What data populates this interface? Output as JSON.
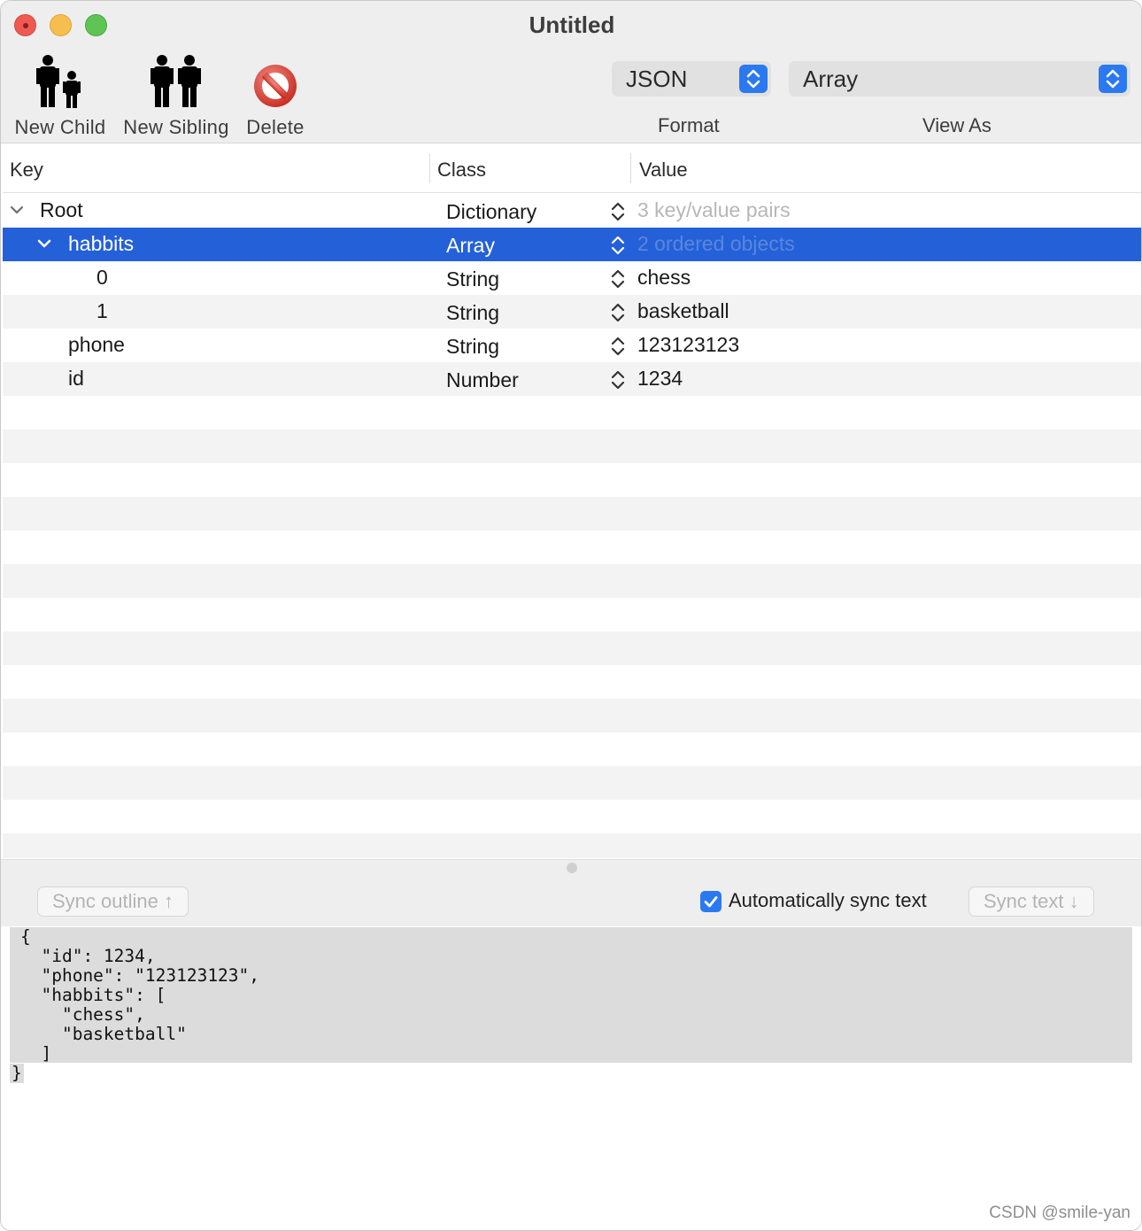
{
  "window": {
    "title": "Untitled"
  },
  "toolbar": {
    "new_child": "New Child",
    "new_sibling": "New Sibling",
    "delete": "Delete",
    "format_value": "JSON",
    "format_caption": "Format",
    "view_as_value": "Array",
    "view_as_caption": "View As"
  },
  "columns": {
    "key": "Key",
    "class": "Class",
    "value": "Value"
  },
  "rows": [
    {
      "key": "Root",
      "class": "Dictionary",
      "value": "3 key/value pairs",
      "expanded": true
    },
    {
      "key": "habbits",
      "class": "Array",
      "value": "2 ordered objects",
      "expanded": true,
      "selected": true
    },
    {
      "key": "0",
      "class": "String",
      "value": "chess"
    },
    {
      "key": "1",
      "class": "String",
      "value": "basketball"
    },
    {
      "key": "phone",
      "class": "String",
      "value": "123123123"
    },
    {
      "key": "id",
      "class": "Number",
      "value": "1234"
    }
  ],
  "bottom": {
    "sync_outline": "Sync outline ↑",
    "auto_sync_label": "Automatically sync text",
    "auto_sync_checked": true,
    "sync_text": "Sync text ↓"
  },
  "json_text": "{\n  \"id\": 1234,\n  \"phone\": \"123123123\",\n  \"habbits\": [\n    \"chess\",\n    \"basketball\"\n  ]",
  "json_text_last": "}",
  "watermark": "CSDN @smile-yan",
  "colors": {
    "selection": "#2460d8",
    "accent": "#2b79f0",
    "close": "#ee5a52",
    "minimize": "#f5be4f",
    "maximize": "#5fc454"
  }
}
